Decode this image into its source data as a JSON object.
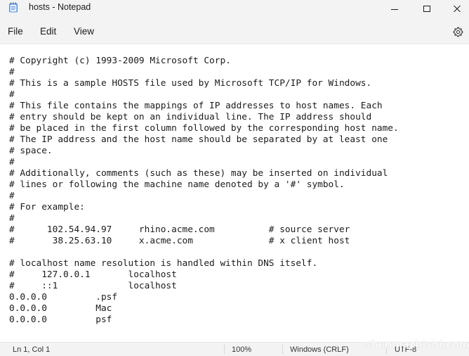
{
  "window": {
    "title": "hosts - Notepad",
    "icon": "notepad-icon"
  },
  "menu": {
    "file": "File",
    "edit": "Edit",
    "view": "View",
    "settings_icon": "gear-icon"
  },
  "editor": {
    "lines": [
      "# Copyright (c) 1993-2009 Microsoft Corp.",
      "#",
      "# This is a sample HOSTS file used by Microsoft TCP/IP for Windows.",
      "#",
      "# This file contains the mappings of IP addresses to host names. Each",
      "# entry should be kept on an individual line. The IP address should",
      "# be placed in the first column followed by the corresponding host name.",
      "# The IP address and the host name should be separated by at least one",
      "# space.",
      "#",
      "# Additionally, comments (such as these) may be inserted on individual",
      "# lines or following the machine name denoted by a '#' symbol.",
      "#",
      "# For example:",
      "#",
      "#      102.54.94.97     rhino.acme.com          # source server",
      "#       38.25.63.10     x.acme.com              # x client host",
      "",
      "# localhost name resolution is handled within DNS itself.",
      "#     127.0.0.1       localhost",
      "#     ::1             localhost",
      "0.0.0.0         .psf",
      "0.0.0.0         Mac",
      "0.0.0.0         psf"
    ]
  },
  "status": {
    "position": "Ln 1, Col 1",
    "zoom": "100%",
    "line_ending": "Windows (CRLF)",
    "encoding": "UTF-8"
  },
  "watermark": "shenmazhishi.com"
}
